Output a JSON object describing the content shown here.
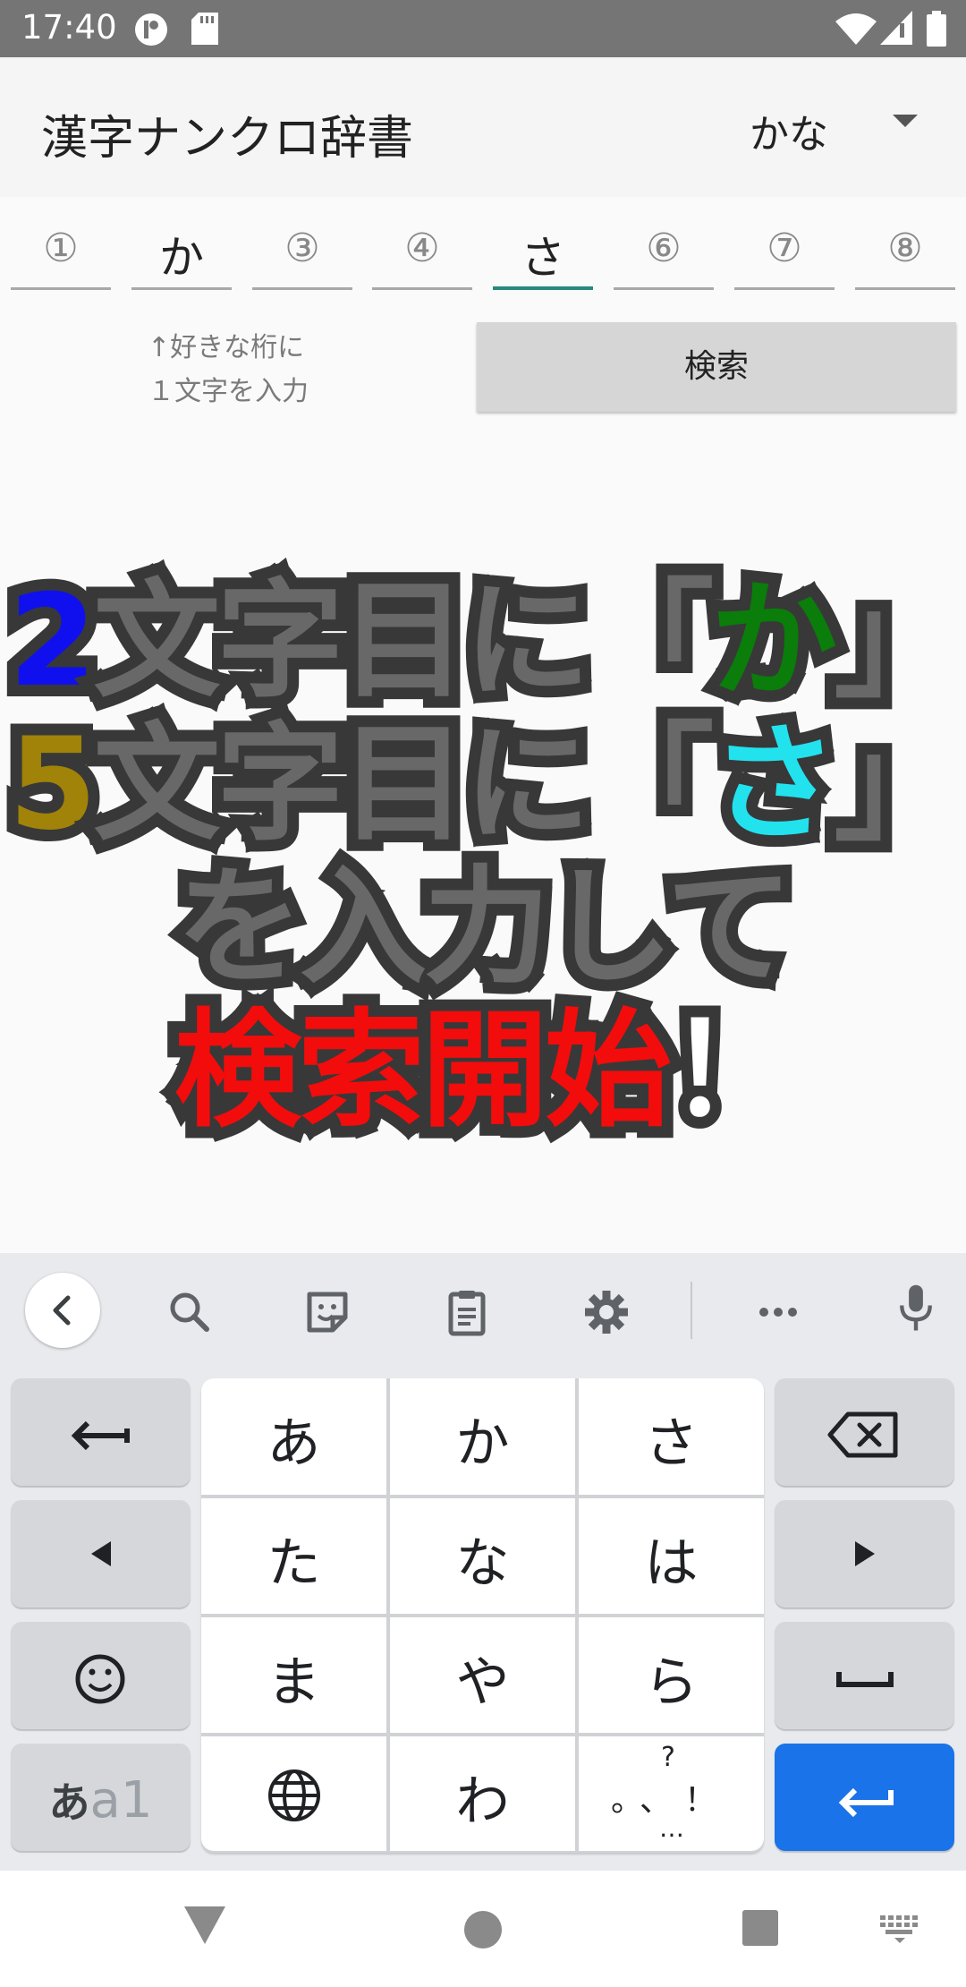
{
  "status_bar": {
    "time": "17:40",
    "icons": [
      "app-indicator-icon",
      "sd-card-icon",
      "wifi-icon",
      "signal-icon",
      "battery-icon"
    ]
  },
  "app_bar": {
    "title": "漢字ナンクロ辞書",
    "mode": "かな"
  },
  "slots": [
    {
      "text": "①",
      "placeholder": true
    },
    {
      "text": "か",
      "placeholder": false
    },
    {
      "text": "③",
      "placeholder": true
    },
    {
      "text": "④",
      "placeholder": true
    },
    {
      "text": "さ",
      "placeholder": false,
      "active": true
    },
    {
      "text": "⑥",
      "placeholder": true
    },
    {
      "text": "⑦",
      "placeholder": true
    },
    {
      "text": "⑧",
      "placeholder": true
    }
  ],
  "hint": {
    "line1": "↑好きな桁に",
    "line2": "１文字を入力"
  },
  "search_button": "検索",
  "caption": {
    "line1": [
      {
        "t": "2",
        "c": "blue"
      },
      {
        "t": "文字目に「",
        "c": "gray"
      },
      {
        "t": "か",
        "c": "green"
      },
      {
        "t": "」",
        "c": "gray"
      }
    ],
    "line2": [
      {
        "t": "5",
        "c": "gold"
      },
      {
        "t": "文字目に「",
        "c": "gray"
      },
      {
        "t": "さ",
        "c": "cyan"
      },
      {
        "t": "」",
        "c": "gray"
      }
    ],
    "line3": [
      {
        "t": "を入力して",
        "c": "gray"
      }
    ],
    "line4": [
      {
        "t": "検索開始",
        "c": "red"
      },
      {
        "t": "！",
        "c": "white"
      }
    ]
  },
  "keyboard": {
    "toolbar_icons": [
      "chevron-left-icon",
      "search-icon",
      "sticker-icon",
      "clipboard-icon",
      "settings-icon",
      "more-icon",
      "mic-icon"
    ],
    "keys": {
      "undo": "←",
      "a": "あ",
      "ka": "か",
      "sa": "さ",
      "ta": "た",
      "na": "な",
      "ha": "は",
      "ma": "ま",
      "ya": "や",
      "ra": "ら",
      "wa": "わ",
      "punct_top": "?",
      "punct_mid": "。、！",
      "punct_bottom": "…",
      "mode_a": "あ",
      "mode_1": "a1"
    }
  },
  "nav_bar": {
    "icons": [
      "back-triangle-icon",
      "home-circle-icon",
      "recents-square-icon",
      "keyboard-switch-icon"
    ]
  },
  "colors": {
    "accent": "#26897e",
    "enter_key": "#1a73e8",
    "status_bar": "#757575"
  }
}
